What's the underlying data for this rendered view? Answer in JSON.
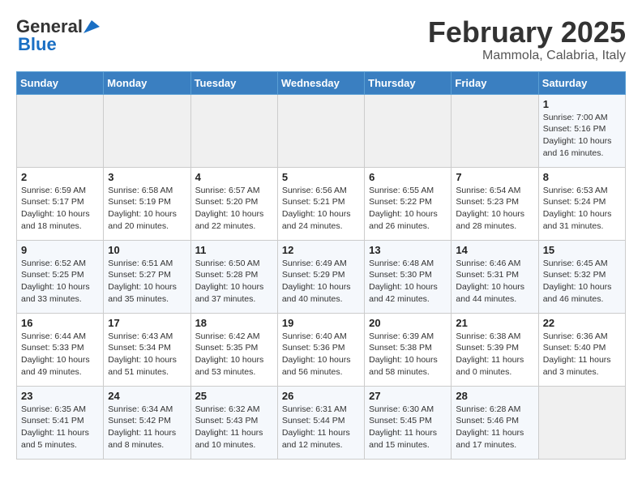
{
  "header": {
    "logo_general": "General",
    "logo_blue": "Blue",
    "month": "February 2025",
    "location": "Mammola, Calabria, Italy"
  },
  "weekdays": [
    "Sunday",
    "Monday",
    "Tuesday",
    "Wednesday",
    "Thursday",
    "Friday",
    "Saturday"
  ],
  "weeks": [
    [
      {
        "day": "",
        "info": ""
      },
      {
        "day": "",
        "info": ""
      },
      {
        "day": "",
        "info": ""
      },
      {
        "day": "",
        "info": ""
      },
      {
        "day": "",
        "info": ""
      },
      {
        "day": "",
        "info": ""
      },
      {
        "day": "1",
        "info": "Sunrise: 7:00 AM\nSunset: 5:16 PM\nDaylight: 10 hours\nand 16 minutes."
      }
    ],
    [
      {
        "day": "2",
        "info": "Sunrise: 6:59 AM\nSunset: 5:17 PM\nDaylight: 10 hours\nand 18 minutes."
      },
      {
        "day": "3",
        "info": "Sunrise: 6:58 AM\nSunset: 5:19 PM\nDaylight: 10 hours\nand 20 minutes."
      },
      {
        "day": "4",
        "info": "Sunrise: 6:57 AM\nSunset: 5:20 PM\nDaylight: 10 hours\nand 22 minutes."
      },
      {
        "day": "5",
        "info": "Sunrise: 6:56 AM\nSunset: 5:21 PM\nDaylight: 10 hours\nand 24 minutes."
      },
      {
        "day": "6",
        "info": "Sunrise: 6:55 AM\nSunset: 5:22 PM\nDaylight: 10 hours\nand 26 minutes."
      },
      {
        "day": "7",
        "info": "Sunrise: 6:54 AM\nSunset: 5:23 PM\nDaylight: 10 hours\nand 28 minutes."
      },
      {
        "day": "8",
        "info": "Sunrise: 6:53 AM\nSunset: 5:24 PM\nDaylight: 10 hours\nand 31 minutes."
      }
    ],
    [
      {
        "day": "9",
        "info": "Sunrise: 6:52 AM\nSunset: 5:25 PM\nDaylight: 10 hours\nand 33 minutes."
      },
      {
        "day": "10",
        "info": "Sunrise: 6:51 AM\nSunset: 5:27 PM\nDaylight: 10 hours\nand 35 minutes."
      },
      {
        "day": "11",
        "info": "Sunrise: 6:50 AM\nSunset: 5:28 PM\nDaylight: 10 hours\nand 37 minutes."
      },
      {
        "day": "12",
        "info": "Sunrise: 6:49 AM\nSunset: 5:29 PM\nDaylight: 10 hours\nand 40 minutes."
      },
      {
        "day": "13",
        "info": "Sunrise: 6:48 AM\nSunset: 5:30 PM\nDaylight: 10 hours\nand 42 minutes."
      },
      {
        "day": "14",
        "info": "Sunrise: 6:46 AM\nSunset: 5:31 PM\nDaylight: 10 hours\nand 44 minutes."
      },
      {
        "day": "15",
        "info": "Sunrise: 6:45 AM\nSunset: 5:32 PM\nDaylight: 10 hours\nand 46 minutes."
      }
    ],
    [
      {
        "day": "16",
        "info": "Sunrise: 6:44 AM\nSunset: 5:33 PM\nDaylight: 10 hours\nand 49 minutes."
      },
      {
        "day": "17",
        "info": "Sunrise: 6:43 AM\nSunset: 5:34 PM\nDaylight: 10 hours\nand 51 minutes."
      },
      {
        "day": "18",
        "info": "Sunrise: 6:42 AM\nSunset: 5:35 PM\nDaylight: 10 hours\nand 53 minutes."
      },
      {
        "day": "19",
        "info": "Sunrise: 6:40 AM\nSunset: 5:36 PM\nDaylight: 10 hours\nand 56 minutes."
      },
      {
        "day": "20",
        "info": "Sunrise: 6:39 AM\nSunset: 5:38 PM\nDaylight: 10 hours\nand 58 minutes."
      },
      {
        "day": "21",
        "info": "Sunrise: 6:38 AM\nSunset: 5:39 PM\nDaylight: 11 hours\nand 0 minutes."
      },
      {
        "day": "22",
        "info": "Sunrise: 6:36 AM\nSunset: 5:40 PM\nDaylight: 11 hours\nand 3 minutes."
      }
    ],
    [
      {
        "day": "23",
        "info": "Sunrise: 6:35 AM\nSunset: 5:41 PM\nDaylight: 11 hours\nand 5 minutes."
      },
      {
        "day": "24",
        "info": "Sunrise: 6:34 AM\nSunset: 5:42 PM\nDaylight: 11 hours\nand 8 minutes."
      },
      {
        "day": "25",
        "info": "Sunrise: 6:32 AM\nSunset: 5:43 PM\nDaylight: 11 hours\nand 10 minutes."
      },
      {
        "day": "26",
        "info": "Sunrise: 6:31 AM\nSunset: 5:44 PM\nDaylight: 11 hours\nand 12 minutes."
      },
      {
        "day": "27",
        "info": "Sunrise: 6:30 AM\nSunset: 5:45 PM\nDaylight: 11 hours\nand 15 minutes."
      },
      {
        "day": "28",
        "info": "Sunrise: 6:28 AM\nSunset: 5:46 PM\nDaylight: 11 hours\nand 17 minutes."
      },
      {
        "day": "",
        "info": ""
      }
    ]
  ]
}
